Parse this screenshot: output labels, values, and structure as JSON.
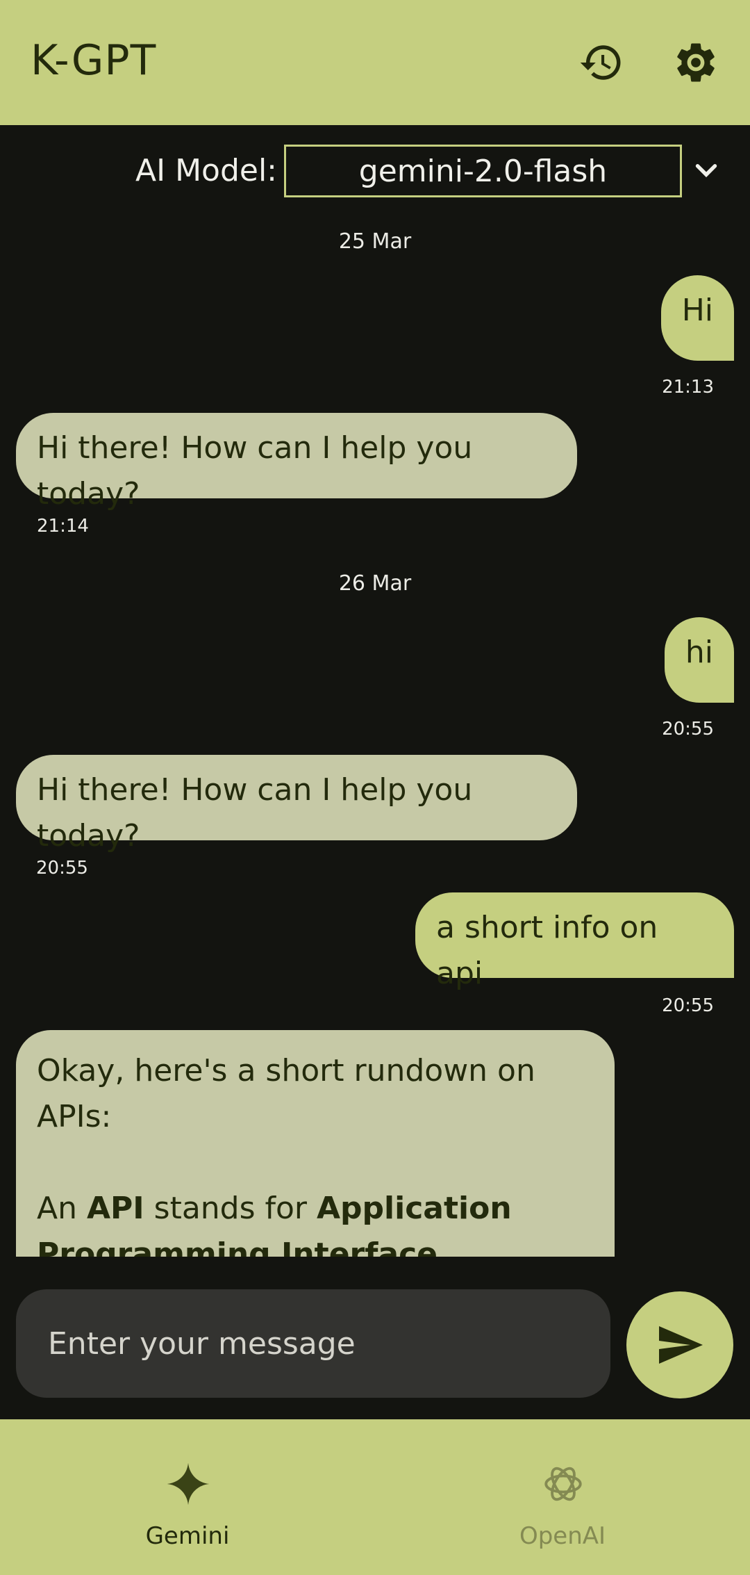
{
  "app": {
    "title": "K-GPT"
  },
  "header": {
    "history_icon": "history-icon",
    "settings_icon": "gear-icon"
  },
  "model": {
    "label": "AI Model:",
    "selected": "gemini-2.0-flash"
  },
  "chat": {
    "messages": [
      {
        "date": "25 Mar"
      },
      {
        "role": "user",
        "text": "Hi",
        "time": "21:13"
      },
      {
        "role": "bot",
        "text": "Hi there! How can I help you today?",
        "time": "21:14"
      },
      {
        "date": "26 Mar"
      },
      {
        "role": "user",
        "text": "hi",
        "time": "20:55"
      },
      {
        "role": "bot",
        "text": "Hi there! How can I help you today?",
        "time": "20:55"
      },
      {
        "role": "user",
        "text": "a short info on api",
        "time": "20:55"
      }
    ],
    "last_bot": {
      "line1": "Okay, here's a short rundown on APIs:",
      "p2_prefix": "An ",
      "p2_bold1": "API",
      "p2_mid": " stands for ",
      "p2_bold2": "Application Programming Interface"
    }
  },
  "composer": {
    "placeholder": "Enter your message",
    "send_icon": "send-icon"
  },
  "nav": {
    "items": [
      {
        "label": "Gemini",
        "icon": "sparkle-icon",
        "active": true
      },
      {
        "label": "OpenAI",
        "icon": "openai-icon",
        "active": false
      }
    ]
  },
  "colors": {
    "accent": "#c5cf80",
    "background": "#131410",
    "bot_bubble": "#c6c9a6",
    "text_dark": "#232a0c"
  }
}
